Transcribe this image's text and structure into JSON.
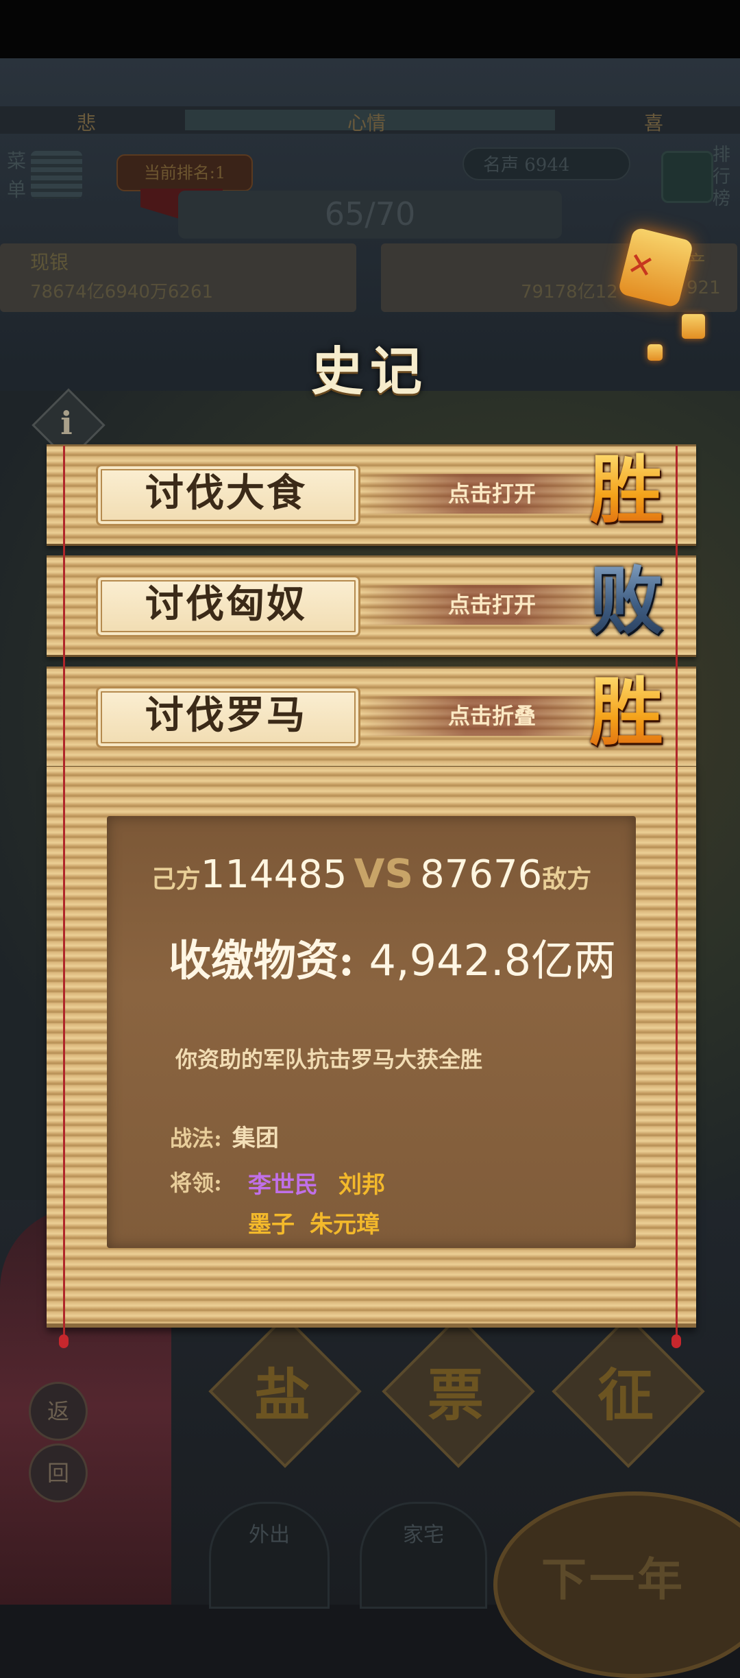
{
  "mood": {
    "left": "悲",
    "center": "心情",
    "right": "喜"
  },
  "menu": {
    "label_top": "菜",
    "label_bottom": "单"
  },
  "rank": {
    "label": "当前排名:1"
  },
  "fame": {
    "label": "名声 6944"
  },
  "rank_list": {
    "label": "排行榜"
  },
  "capacity": {
    "value": "65/70"
  },
  "cash": {
    "label": "现银",
    "value": "78674亿6940万6261"
  },
  "assets": {
    "label": "产",
    "value": "79178亿12",
    "value_tail": "921"
  },
  "dialog": {
    "title": "史记",
    "entries": [
      {
        "name": "讨伐大食",
        "action": "点击打开",
        "result": "胜"
      },
      {
        "name": "讨伐匈奴",
        "action": "点击打开",
        "result": "败"
      },
      {
        "name": "讨伐罗马",
        "action": "点击折叠",
        "result": "胜"
      }
    ],
    "detail": {
      "own_label": "己方",
      "own_power": "114485",
      "vs": "VS",
      "enemy_power": "87676",
      "enemy_label": "敌方",
      "loot_label": "收缴物资:",
      "loot_value": "4,942.8亿两",
      "message": "你资助的军队抗击罗马大获全胜",
      "tactic_label": "战法:",
      "tactic_value": "集团",
      "generals_label": "将领:",
      "generals": [
        "李世民",
        "刘邦",
        "墨子",
        "朱元璋"
      ]
    }
  },
  "actions": {
    "salt": "盐",
    "ticket": "票",
    "conscript": "征"
  },
  "side_buttons": {
    "back1": "返",
    "back2": "回"
  },
  "bottom": {
    "go_out": "外出",
    "home": "家宅",
    "next_year": "下一年"
  },
  "colors": {
    "win": "#f4a21a",
    "lose": "#3d5b80",
    "purple_general": "#c070e8",
    "gold_general": "#f3b92b"
  }
}
